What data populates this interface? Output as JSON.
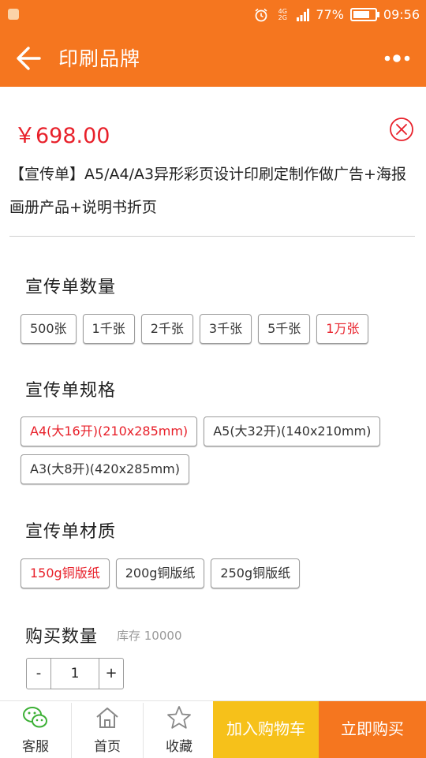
{
  "status_bar": {
    "network": "4G 2G",
    "battery": "77%",
    "battery_level": 0.77,
    "time": "09:56"
  },
  "header": {
    "title": "印刷品牌",
    "back_icon": "arrow-left-icon",
    "more_icon": "more-dots-icon"
  },
  "product": {
    "price": "￥698.00",
    "title": "【宣传单】A5/A4/A3异形彩页设计印刷定制作做广告+海报画册产品+说明书折页",
    "close_icon": "close-circle-icon"
  },
  "sections": {
    "quantity": {
      "title": "宣传单数量",
      "options": [
        "500张",
        "1千张",
        "2千张",
        "3千张",
        "5千张",
        "1万张"
      ],
      "selected": "1万张"
    },
    "size": {
      "title": "宣传单规格",
      "options": [
        "A4(大16开)(210x285mm)",
        "A5(大32开)(140x210mm)",
        "A3(大8开)(420x285mm)"
      ],
      "selected": "A4(大16开)(210x285mm)"
    },
    "material": {
      "title": "宣传单材质",
      "options": [
        "150g铜版纸",
        "200g铜版纸",
        "250g铜版纸"
      ],
      "selected": "150g铜版纸"
    }
  },
  "purchase": {
    "title": "购买数量",
    "stock": "库存 10000",
    "minus": "-",
    "value": "1",
    "plus": "+"
  },
  "bottom_bar": {
    "service": "客服",
    "home": "首页",
    "favorite": "收藏",
    "add_to_cart": "加入购物车",
    "buy_now": "立即购买"
  },
  "colors": {
    "brand": "#f5761f",
    "accent_red": "#e8202a",
    "cart_yellow": "#f6c11a",
    "wechat_green": "#3cb035"
  }
}
